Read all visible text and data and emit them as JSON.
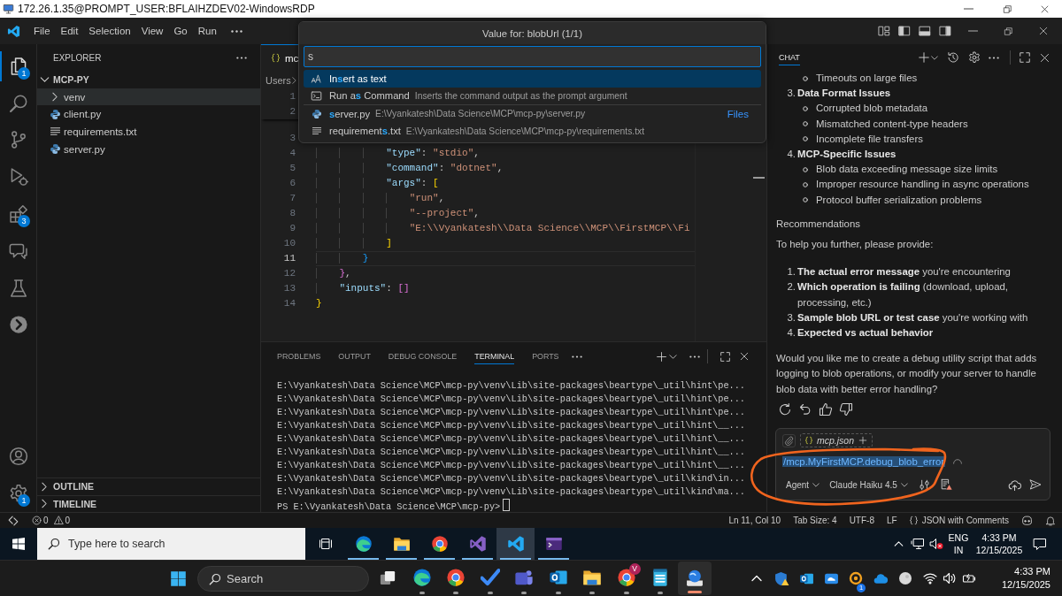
{
  "rdp_window": {
    "title": "172.26.1.35@PROMPT_USER:BFLAIHZDEV02-WindowsRDP"
  },
  "menu_bar": {
    "items": [
      "File",
      "Edit",
      "Selection",
      "View",
      "Go",
      "Run"
    ]
  },
  "activity_bar": {
    "items": [
      {
        "selected": true,
        "badge": "1"
      },
      {
        "selected": false
      },
      {
        "selected": false
      },
      {
        "selected": false
      },
      {
        "selected": false,
        "badge": "3"
      },
      {
        "selected": false
      },
      {
        "selected": false
      },
      {
        "selected": false
      }
    ],
    "bottom": [
      {
        "selected": false
      },
      {
        "selected": false,
        "badge": "1"
      }
    ]
  },
  "explorer": {
    "title": "EXPLORER",
    "folder": {
      "label": "MCP-PY",
      "expanded": true,
      "children": [
        {
          "kind": "folder",
          "label": "venv",
          "expanded": false,
          "selected": true
        },
        {
          "kind": "python",
          "label": "client.py",
          "selected": false
        },
        {
          "kind": "text",
          "label": "requirements.txt",
          "selected": false
        },
        {
          "kind": "python",
          "label": "server.py",
          "selected": false
        }
      ]
    },
    "sections": [
      {
        "label": "OUTLINE",
        "expanded": false
      },
      {
        "label": "TIMELINE",
        "expanded": false
      }
    ]
  },
  "editor": {
    "tabs": [
      {
        "label": "mc",
        "selected": true
      }
    ],
    "breadcrumb": [
      "Users"
    ],
    "lines": [
      {
        "number": "1",
        "current": false
      },
      {
        "number": "2",
        "current": false
      },
      {
        "number": "3",
        "current": false
      },
      {
        "number": "4",
        "current": false,
        "tokens": [
          {
            "kind": "key",
            "text": "            \"type\""
          },
          {
            "kind": "punct",
            "text": ": "
          },
          {
            "kind": "string",
            "text": "\"stdio\""
          },
          {
            "kind": "punct",
            "text": ","
          }
        ]
      },
      {
        "number": "5",
        "current": false,
        "tokens": [
          {
            "kind": "key",
            "text": "            \"command\""
          },
          {
            "kind": "punct",
            "text": ": "
          },
          {
            "kind": "string",
            "text": "\"dotnet\""
          },
          {
            "kind": "punct",
            "text": ","
          }
        ]
      },
      {
        "number": "6",
        "current": false,
        "tokens": [
          {
            "kind": "key",
            "text": "            \"args\""
          },
          {
            "kind": "punct",
            "text": ": "
          },
          {
            "kind": "bracket1",
            "text": "["
          }
        ]
      },
      {
        "number": "7",
        "current": false,
        "tokens": [
          {
            "kind": "string",
            "text": "                \"run\""
          },
          {
            "kind": "punct",
            "text": ","
          }
        ]
      },
      {
        "number": "8",
        "current": false,
        "tokens": [
          {
            "kind": "string",
            "text": "                \"--project\""
          },
          {
            "kind": "punct",
            "text": ","
          }
        ]
      },
      {
        "number": "9",
        "current": false,
        "tokens": [
          {
            "kind": "string",
            "text": "                \"E:\\\\Vyankatesh\\\\Data Science\\\\MCP\\\\FirstMCP\\\\Fi"
          }
        ]
      },
      {
        "number": "10",
        "current": false,
        "tokens": [
          {
            "kind": "bracket1",
            "text": "            ]"
          }
        ]
      },
      {
        "number": "11",
        "current": true,
        "tokens": [
          {
            "kind": "bracket3",
            "text": "        }"
          }
        ]
      },
      {
        "number": "12",
        "current": false,
        "tokens": [
          {
            "kind": "bracket2",
            "text": "    }"
          },
          {
            "kind": "punct",
            "text": ","
          }
        ]
      },
      {
        "number": "13",
        "current": false,
        "tokens": [
          {
            "kind": "key",
            "text": "    \"inputs\""
          },
          {
            "kind": "punct",
            "text": ": "
          },
          {
            "kind": "bracket2",
            "text": "[]"
          }
        ]
      },
      {
        "number": "14",
        "current": false,
        "tokens": [
          {
            "kind": "bracket1",
            "text": "}"
          }
        ]
      }
    ]
  },
  "quick_input": {
    "title": "Value for: blobUrl (1/1)",
    "value": "s",
    "items": [
      {
        "kind": "insert",
        "label": "In**s**ert as text",
        "selected": true
      },
      {
        "kind": "command",
        "label": "Run a**s** Command",
        "description": "Inserts the command output as the prompt argument",
        "selected": false
      },
      {
        "kind": "python",
        "label": "**s**erver.py",
        "description": "E:\\Vyankatesh\\Data Science\\MCP\\mcp-py\\server.py",
        "group": "Files",
        "selected": false
      },
      {
        "kind": "textfile",
        "label": "requirement**s**.txt",
        "description": "E:\\Vyankatesh\\Data Science\\MCP\\mcp-py\\requirements.txt",
        "selected": false
      }
    ]
  },
  "panel": {
    "tabs": [
      {
        "label": "PROBLEMS",
        "selected": false
      },
      {
        "label": "OUTPUT",
        "selected": false
      },
      {
        "label": "DEBUG CONSOLE",
        "selected": false
      },
      {
        "label": "TERMINAL",
        "selected": true
      },
      {
        "label": "PORTS",
        "selected": false
      }
    ],
    "terminal": {
      "lines": [
        "E:\\Vyankatesh\\Data Science\\MCP\\mcp-py\\venv\\Lib\\site-packages\\beartype\\_util\\hint\\pe...",
        "E:\\Vyankatesh\\Data Science\\MCP\\mcp-py\\venv\\Lib\\site-packages\\beartype\\_util\\hint\\pe...",
        "E:\\Vyankatesh\\Data Science\\MCP\\mcp-py\\venv\\Lib\\site-packages\\beartype\\_util\\hint\\pe...",
        "E:\\Vyankatesh\\Data Science\\MCP\\mcp-py\\venv\\Lib\\site-packages\\beartype\\_util\\hint\\__...",
        "E:\\Vyankatesh\\Data Science\\MCP\\mcp-py\\venv\\Lib\\site-packages\\beartype\\_util\\hint\\__...",
        "E:\\Vyankatesh\\Data Science\\MCP\\mcp-py\\venv\\Lib\\site-packages\\beartype\\_util\\hint\\__...",
        "E:\\Vyankatesh\\Data Science\\MCP\\mcp-py\\venv\\Lib\\site-packages\\beartype\\_util\\hint\\__...",
        "E:\\Vyankatesh\\Data Science\\MCP\\mcp-py\\venv\\Lib\\site-packages\\beartype\\_util\\kind\\in...",
        "E:\\Vyankatesh\\Data Science\\MCP\\mcp-py\\venv\\Lib\\site-packages\\beartype\\_util\\kind\\ma..."
      ],
      "prompt": "PS E:\\Vyankatesh\\Data Science\\MCP\\mcp-py>"
    }
  },
  "chat": {
    "tabs": [
      {
        "label": "CHAT",
        "selected": true
      }
    ],
    "message": [
      {
        "kind": "bullet",
        "text": "Timeouts on large files"
      },
      {
        "kind": "section",
        "number": "3.",
        "text": "Data Format Issues"
      },
      {
        "kind": "bullet",
        "text": "Corrupted blob metadata"
      },
      {
        "kind": "bullet",
        "text": "Mismatched content-type headers"
      },
      {
        "kind": "bullet",
        "text": "Incomplete file transfers"
      },
      {
        "kind": "section",
        "number": "4.",
        "text": "MCP-Specific Issues"
      },
      {
        "kind": "bullet",
        "text": "Blob data exceeding message size limits"
      },
      {
        "kind": "bullet",
        "text": "Improper resource handling in async operations"
      },
      {
        "kind": "bullet",
        "text": "Protocol buffer serialization problems"
      },
      {
        "kind": "paragraph",
        "text": "Recommendations"
      },
      {
        "kind": "paragraph",
        "text": "To help you further, please provide:"
      },
      {
        "kind": "item",
        "number": "1.",
        "text": "**The actual error message** you're encountering"
      },
      {
        "kind": "item",
        "number": "2.",
        "text": "**Which operation is failing** (download, upload, processing, etc.)"
      },
      {
        "kind": "item",
        "number": "3.",
        "text": "**Sample blob URL or test case** you're working with"
      },
      {
        "kind": "section",
        "number": "4.",
        "text": "Expected vs actual behavior"
      },
      {
        "kind": "paragraph",
        "text": "Would you like me to create a debug utility script that adds logging to blob operations, or modify your server to handle blob data with better error handling?"
      }
    ],
    "input": {
      "attachments": [
        {
          "label": "mcp.json"
        }
      ],
      "value": "/mcp.MyFirstMCP.debug_blob_error",
      "mode": "Agent",
      "model": "Claude Haiku 4.5"
    }
  },
  "status_bar": {
    "errors": "0",
    "warnings": "0",
    "items": [
      {
        "kind": "text",
        "label": "Ln 11, Col 10"
      },
      {
        "kind": "text",
        "label": "Tab Size: 4"
      },
      {
        "kind": "text",
        "label": "UTF-8"
      },
      {
        "kind": "text",
        "label": "LF"
      },
      {
        "kind": "language",
        "label": "JSON with Comments"
      }
    ]
  },
  "remote_taskbar": {
    "search": {
      "placeholder": "Type here to search"
    },
    "apps": [
      {
        "running": true,
        "active": false
      },
      {
        "running": true,
        "active": false
      },
      {
        "running": true,
        "active": false
      },
      {
        "running": true,
        "active": false
      },
      {
        "running": true,
        "active": true
      },
      {
        "running": true,
        "active": false
      }
    ],
    "tray": {
      "language": "ENG",
      "region": "IN",
      "time": "4:33 PM",
      "date": "12/15/2025"
    }
  },
  "taskbar": {
    "search": {
      "placeholder": "Search"
    },
    "apps": [
      {
        "running": true,
        "active": false
      },
      {
        "running": true,
        "active": false
      },
      {
        "running": true,
        "active": false
      },
      {
        "running": true,
        "active": false
      },
      {
        "running": true,
        "active": false
      },
      {
        "running": true,
        "active": false
      },
      {
        "running": true,
        "active": false,
        "badge": "V"
      },
      {
        "running": true,
        "active": false
      },
      {
        "running": true,
        "active": true
      }
    ],
    "tray": {
      "badge": "1",
      "time": "4:33 PM",
      "date": "12/15/2025"
    }
  }
}
